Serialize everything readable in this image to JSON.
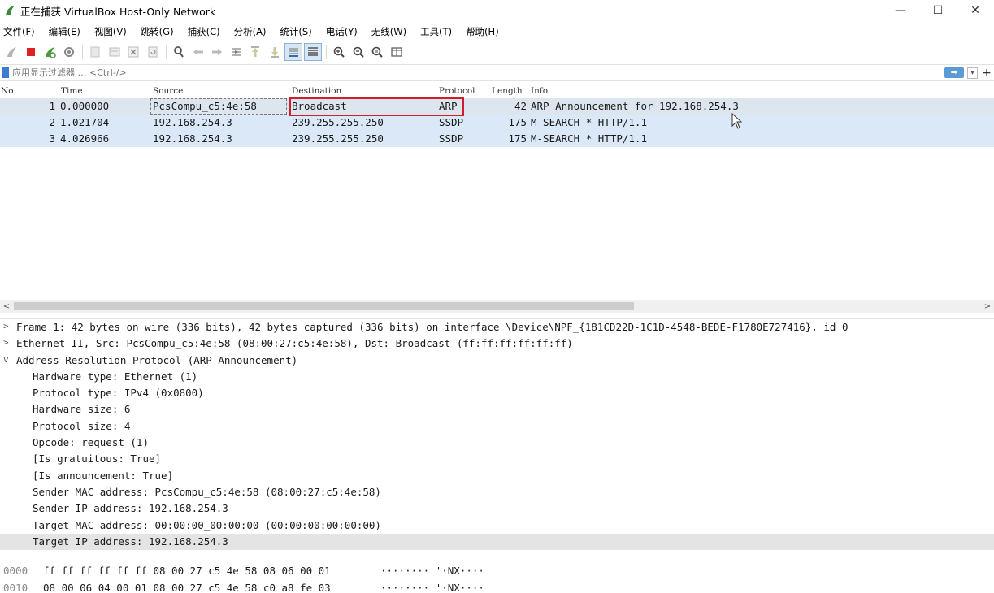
{
  "window": {
    "title": "正在捕获 VirtualBox Host-Only Network",
    "minimize": "—",
    "maximize": "☐",
    "close": "✕"
  },
  "menu": [
    "文件(F)",
    "编辑(E)",
    "视图(V)",
    "跳转(G)",
    "捕获(C)",
    "分析(A)",
    "统计(S)",
    "电话(Y)",
    "无线(W)",
    "工具(T)",
    "帮助(H)"
  ],
  "filter": {
    "placeholder": "应用显示过滤器 … <Ctrl-/>",
    "apply_icon": "➡",
    "dropdown_icon": "▾",
    "add_icon": "+"
  },
  "packet_list": {
    "headers": {
      "no": "No.",
      "time": "Time",
      "source": "Source",
      "destination": "Destination",
      "protocol": "Protocol",
      "length": "Length",
      "info": "Info"
    },
    "rows": [
      {
        "no": "1",
        "time": "0.000000",
        "source": "PcsCompu_c5:4e:58",
        "destination": "Broadcast",
        "protocol": "ARP",
        "length": "42",
        "info": "ARP Announcement for 192.168.254.3"
      },
      {
        "no": "2",
        "time": "1.021704",
        "source": "192.168.254.3",
        "destination": "239.255.255.250",
        "protocol": "SSDP",
        "length": "175",
        "info": "M-SEARCH * HTTP/1.1"
      },
      {
        "no": "3",
        "time": "4.026966",
        "source": "192.168.254.3",
        "destination": "239.255.255.250",
        "protocol": "SSDP",
        "length": "175",
        "info": "M-SEARCH * HTTP/1.1"
      }
    ]
  },
  "scroll": {
    "left": "<",
    "right": ">"
  },
  "details": [
    {
      "arrow": ">",
      "text": "Frame 1: 42 bytes on wire (336 bits), 42 bytes captured (336 bits) on interface \\Device\\NPF_{181CD22D-1C1D-4548-BEDE-F1780E727416}, id 0"
    },
    {
      "arrow": ">",
      "text": "Ethernet II, Src: PcsCompu_c5:4e:58 (08:00:27:c5:4e:58), Dst: Broadcast (ff:ff:ff:ff:ff:ff)"
    },
    {
      "arrow": "v",
      "text": "Address Resolution Protocol (ARP Announcement)"
    },
    {
      "text": "Hardware type: Ethernet (1)"
    },
    {
      "text": "Protocol type: IPv4 (0x0800)"
    },
    {
      "text": "Hardware size: 6"
    },
    {
      "text": "Protocol size: 4"
    },
    {
      "text": "Opcode: request (1)"
    },
    {
      "text": "[Is gratuitous: True]"
    },
    {
      "text": "[Is announcement: True]"
    },
    {
      "text": "Sender MAC address: PcsCompu_c5:4e:58 (08:00:27:c5:4e:58)"
    },
    {
      "text": "Sender IP address: 192.168.254.3"
    },
    {
      "text": "Target MAC address: 00:00:00_00:00:00 (00:00:00:00:00:00)"
    },
    {
      "text": "Target IP address: 192.168.254.3"
    }
  ],
  "bytes": [
    {
      "offset": "0000",
      "hex": "ff ff ff ff ff ff 08 00  27 c5 4e 58 08 06 00 01",
      "ascii": "········ '·NX····"
    },
    {
      "offset": "0010",
      "hex": "08 00 06 04 00 01 08 00  27 c5 4e 58 c0 a8 fe 03",
      "ascii": "········ '·NX····"
    }
  ],
  "colors": {
    "selected_row": "#dde6ef",
    "ssdp_row": "#dae8f7",
    "highlight_box": "#d01f2a",
    "apply_button": "#5b9bd5"
  },
  "toolbar_icons": [
    "start-icon",
    "stop-icon",
    "restart-icon",
    "options-icon",
    "open-icon",
    "save-icon",
    "close-file-icon",
    "reload-icon",
    "find-icon",
    "back-icon",
    "forward-icon",
    "goto-icon",
    "first-icon",
    "last-icon",
    "autoscroll-icon",
    "colorize-icon",
    "zoom-in-icon",
    "zoom-out-icon",
    "zoom-normal-icon",
    "resize-columns-icon"
  ]
}
